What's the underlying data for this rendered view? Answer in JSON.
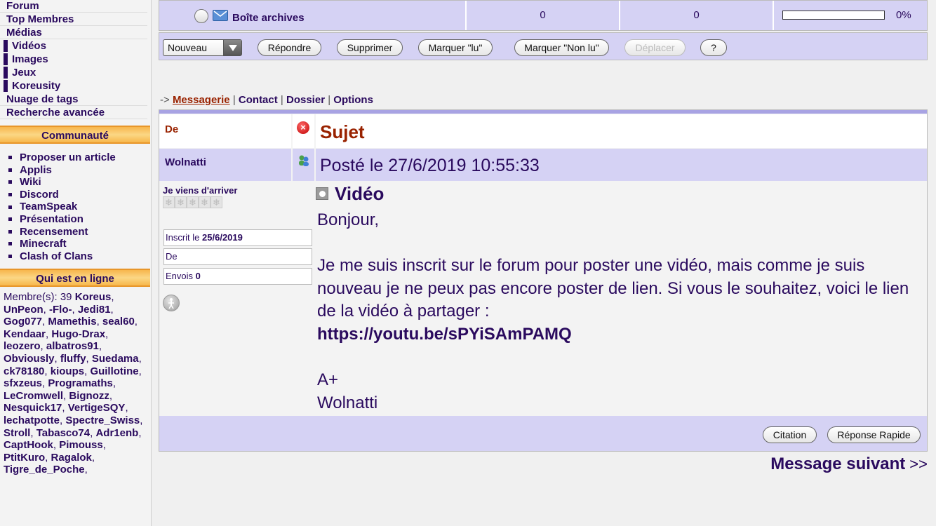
{
  "sidebar": {
    "nav": [
      "Forum",
      "Top Membres",
      "Médias"
    ],
    "media_sub": [
      "Vidéos",
      "Images",
      "Jeux",
      "Koreusity"
    ],
    "nav2": [
      "Nuage de tags",
      "Recherche avancée"
    ],
    "community_title": "Communauté",
    "community_items": [
      "Proposer un article",
      "Applis",
      "Wiki",
      "Discord",
      "TeamSpeak",
      "Présentation",
      "Recensement",
      "Minecraft",
      "Clash of Clans"
    ],
    "online_title": "Qui est en ligne",
    "online_prefix": "Membre(s): 39",
    "online_members": [
      "Koreus",
      "UnPeon",
      "-Flo-",
      "Jedi81",
      "Gog077",
      "Mamethis",
      "seal60",
      "Kendaar",
      "Hugo-Drax",
      "leozero",
      "albatros91",
      "Obviously",
      "fluffy",
      "Suedama",
      "ck78180",
      "kioups",
      "Guillotine",
      "sfxzeus",
      "Programaths",
      "LeCromwell",
      "Bignozz",
      "Nesquick17",
      "VertigeSQY",
      "lechatpotte",
      "Spectre_Swiss",
      "Stroll",
      "Tabasco74",
      "Adr1enb",
      "CaptHook",
      "Pimouss",
      "PtitKuro",
      "Ragalok",
      "Tigre_de_Poche"
    ]
  },
  "mailbox": {
    "name": "Boîte archives",
    "count1": "0",
    "count2": "0",
    "usage_percent": "0%",
    "usage_fraction": 0
  },
  "toolbar": {
    "select_value": "Nouveau",
    "reply": "Répondre",
    "delete": "Supprimer",
    "mark_read": "Marquer \"lu\"",
    "mark_unread": "Marquer \"Non lu\"",
    "move": "Déplacer",
    "help": "?"
  },
  "breadcrumb": {
    "arrow": "->",
    "messagerie": "Messagerie",
    "contact": "Contact",
    "dossier": "Dossier",
    "options": "Options",
    "sep": "|"
  },
  "message": {
    "from_label": "De",
    "subject_label": "Sujet",
    "author": "Wolnatti",
    "posted": "Posté le 27/6/2019 10:55:33",
    "rank": "Je viens d'arriver",
    "registered_label": "Inscrit le",
    "registered_date": "25/6/2019",
    "from_field": "De",
    "posts_label": "Envois",
    "posts_count": "0",
    "title": "Vidéo",
    "greeting": "Bonjour,",
    "body": "Je me suis inscrit sur le forum pour poster une vidéo, mais comme je suis nouveau je ne peux pas encore poster de lien. Si vous le souhaitez, voici le lien de la vidéo à partager :",
    "link": "https://youtu.be/sPYiSAmPAMQ",
    "signoff": "A+",
    "signature": "Wolnatti",
    "quote_button": "Citation",
    "quick_reply_button": "Réponse Rapide"
  },
  "next_message": {
    "label": "Message suivant",
    "arrow": ">>"
  },
  "colors": {
    "accent": "#2a0a5e",
    "header_bg": "#d5d2f4",
    "section_orange": "#f7b64c",
    "subject_red": "#992200"
  }
}
